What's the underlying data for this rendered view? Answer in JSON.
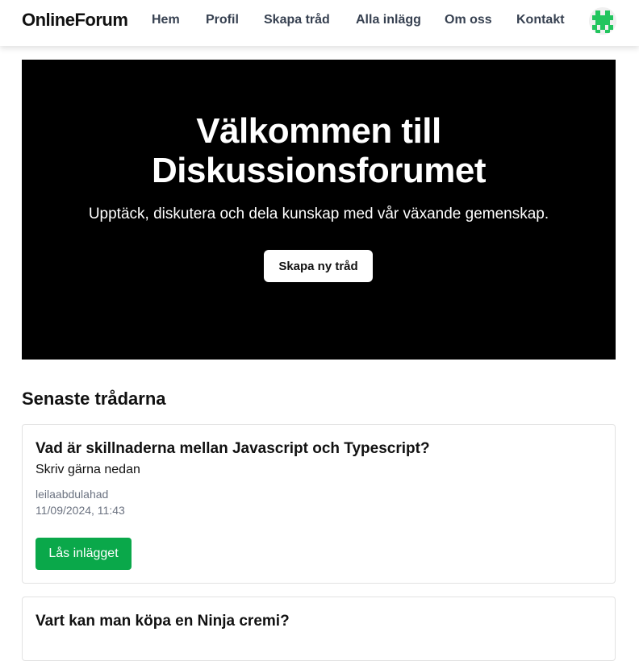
{
  "header": {
    "brand": "OnlineForum",
    "nav": [
      "Hem",
      "Profil",
      "Skapa tråd",
      "Alla inlägg",
      "Om oss",
      "Kontakt"
    ],
    "avatar_icon": "pixel-avatar-icon",
    "avatar_color": "#22c55e"
  },
  "hero": {
    "title_line1": "Välkommen till",
    "title_line2": "Diskussionsforumet",
    "subtitle": "Upptäck, diskutera och dela kunskap med vår växande gemenskap.",
    "button_label": "Skapa ny tråd"
  },
  "threads_section": {
    "title": "Senaste trådarna",
    "threads": [
      {
        "title": "Vad är skillnaderna mellan Javascript och Typescript?",
        "body": "Skriv gärna nedan",
        "author": "leilaabdulahad",
        "date": "11/09/2024, 11:43",
        "button_label": "Lås inlägget"
      },
      {
        "title": "Vart kan man köpa en Ninja cremi?"
      }
    ]
  },
  "colors": {
    "hero_bg": "#000000",
    "read_button": "#0aa84a"
  }
}
